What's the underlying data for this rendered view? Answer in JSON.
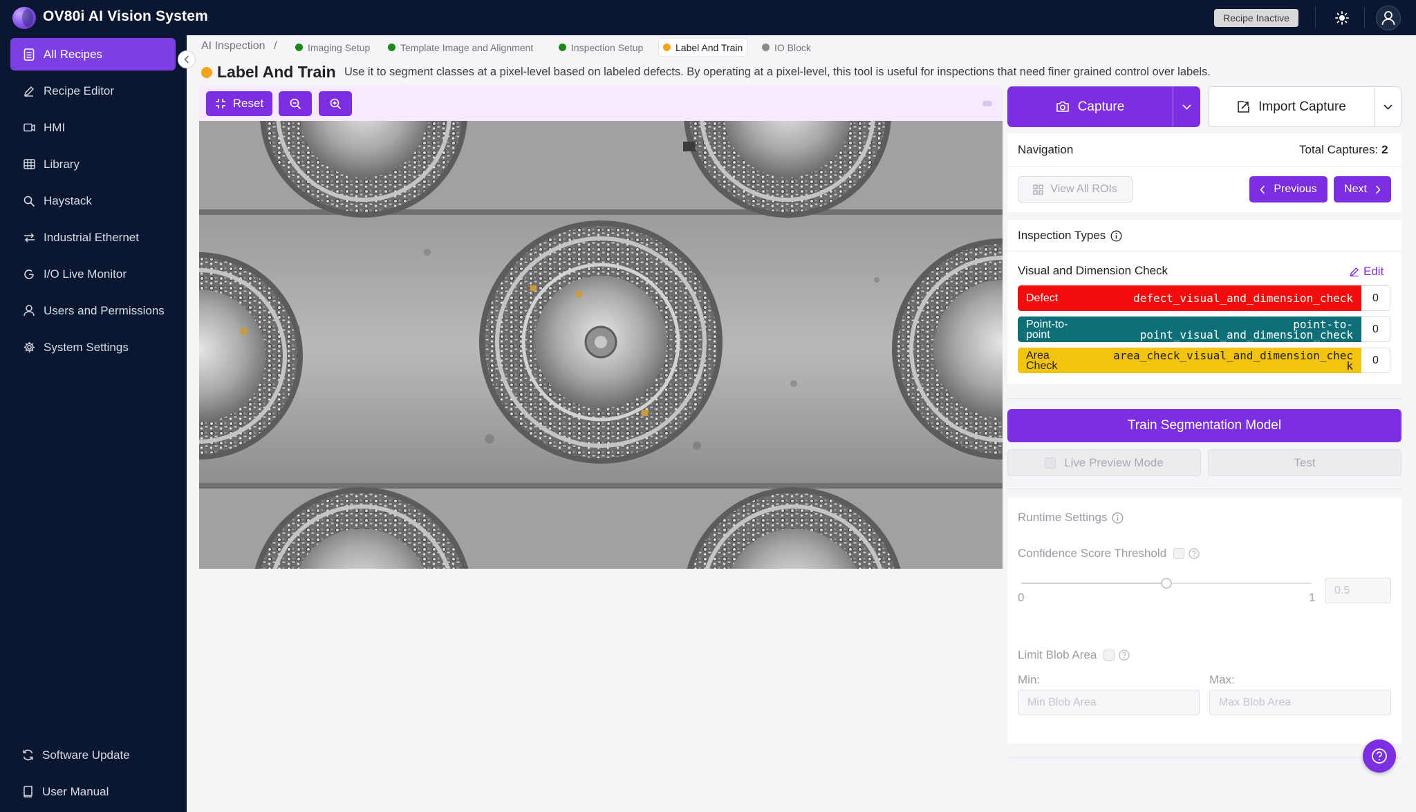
{
  "app": {
    "title": "OV80i AI Vision System",
    "recipe_status": "Recipe Inactive"
  },
  "sidebar": {
    "items": [
      {
        "label": "All Recipes",
        "icon": "document-list-icon",
        "active": true
      },
      {
        "label": "Recipe Editor",
        "icon": "pencil-icon"
      },
      {
        "label": "HMI",
        "icon": "monitor-icon"
      },
      {
        "label": "Library",
        "icon": "grid-icon"
      },
      {
        "label": "Haystack",
        "icon": "search-icon"
      },
      {
        "label": "Industrial Ethernet",
        "icon": "arrows-icon"
      },
      {
        "label": "I/O Live Monitor",
        "icon": "gauge-icon"
      },
      {
        "label": "Users and Permissions",
        "icon": "user-icon"
      },
      {
        "label": "System Settings",
        "icon": "gear-icon"
      }
    ],
    "bottom": [
      {
        "label": "Software Update",
        "icon": "refresh-icon"
      },
      {
        "label": "User Manual",
        "icon": "book-icon"
      }
    ]
  },
  "breadcrumb": {
    "root": "AI Inspection",
    "separator": "/",
    "steps": [
      {
        "label": "Imaging Setup",
        "status_color": "#1a8a1a"
      },
      {
        "label": "Template Image and Alignment",
        "status_color": "#1a8a1a"
      },
      {
        "label": "Inspection Setup",
        "status_color": "#1a8a1a"
      },
      {
        "label": "Label And Train",
        "status_color": "#f4a21a",
        "active": true
      },
      {
        "label": "IO Block",
        "status_color": "#8a8a8a"
      }
    ]
  },
  "page": {
    "title": "Label And Train",
    "description": "Use it to segment classes at a pixel-level based on labeled defects. By operating at a pixel-level, this tool is useful for inspections that need finer grained control over labels."
  },
  "image_toolbar": {
    "reset_label": "Reset",
    "zoom_out_icon": "zoom-out-icon",
    "zoom_in_icon": "zoom-in-icon"
  },
  "capture": {
    "capture_label": "Capture",
    "import_label": "Import Capture"
  },
  "navigation": {
    "title": "Navigation",
    "total_label": "Total Captures:",
    "total_value": "2",
    "view_rois_label": "View All ROIs",
    "previous_label": "Previous",
    "next_label": "Next"
  },
  "inspection_types": {
    "title": "Inspection Types",
    "group_name": "Visual and Dimension Check",
    "edit_label": "Edit",
    "classes": [
      {
        "name": "Defect",
        "id": "defect_visual_and_dimension_check",
        "count": "0",
        "color": "#f20d0d",
        "text_color": "#ffffff"
      },
      {
        "name": "Point-to-\npoint",
        "id": "point-to-\npoint_visual_and_dimension_check",
        "count": "0",
        "color": "#0f6f78",
        "text_color": "#ffffff"
      },
      {
        "name": "Area\nCheck",
        "id": "area_check_visual_and_dimension_chec\nk",
        "count": "0",
        "color": "#f2c40f",
        "text_color": "#1f2024"
      }
    ]
  },
  "train": {
    "train_label": "Train Segmentation Model",
    "live_preview_label": "Live Preview Mode",
    "test_label": "Test"
  },
  "runtime": {
    "title": "Runtime Settings",
    "confidence_label": "Confidence Score Threshold",
    "slider_min": "0",
    "slider_max": "1",
    "slider_value": 0.5,
    "slider_value_text": "0.5",
    "limit_blob_label": "Limit Blob Area",
    "min_label": "Min:",
    "max_label": "Max:",
    "min_placeholder": "Min Blob Area",
    "max_placeholder": "Max Blob Area"
  },
  "colors": {
    "accent": "#7b2fe0",
    "sidebar_bg": "#0b1730",
    "toolbar_bg": "#f6eaff"
  }
}
